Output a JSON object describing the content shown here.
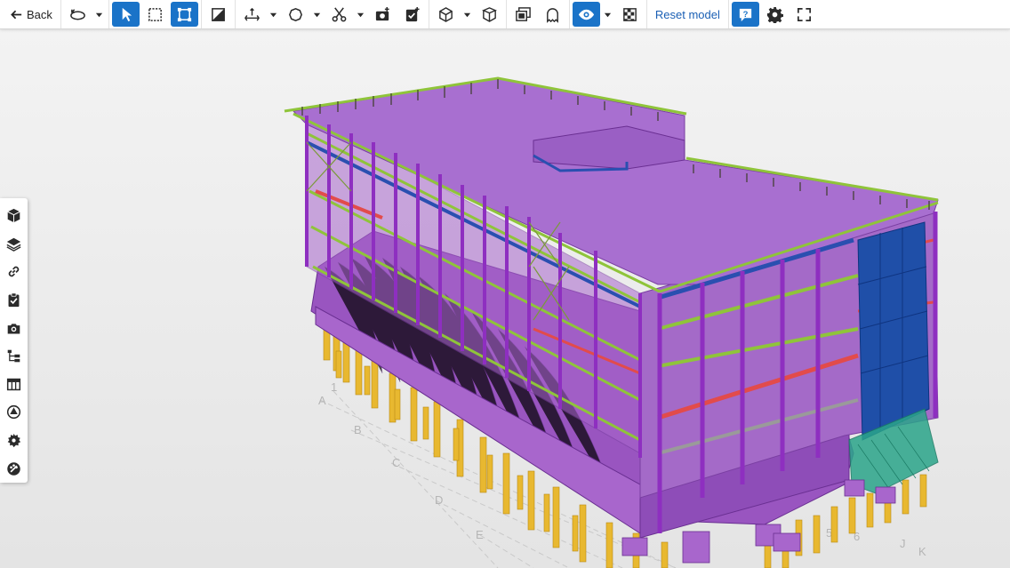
{
  "toolbar": {
    "back_label": "Back",
    "reset_label": "Reset model",
    "active_color": "#1a73c8",
    "tools": [
      {
        "name": "orbit",
        "icon": "orbit-icon",
        "active": false
      },
      {
        "name": "select",
        "icon": "cursor-icon",
        "active": true
      },
      {
        "name": "area-select",
        "icon": "area-select-icon",
        "active": false
      },
      {
        "name": "fit",
        "icon": "fit-bounds-icon",
        "active": true
      },
      {
        "name": "ghost",
        "icon": "ghost-toggle-icon",
        "active": false
      },
      {
        "name": "measure",
        "icon": "measure-icon",
        "active": false
      },
      {
        "name": "markup",
        "icon": "cloud-markup-icon",
        "active": false
      },
      {
        "name": "clip",
        "icon": "scissors-icon",
        "active": false
      },
      {
        "name": "snapshot",
        "icon": "camera-add-icon",
        "active": false
      },
      {
        "name": "add-todo",
        "icon": "todo-add-icon",
        "active": false
      },
      {
        "name": "section-box",
        "icon": "section-box-icon",
        "active": false
      },
      {
        "name": "explode",
        "icon": "open-box-icon",
        "active": false
      },
      {
        "name": "views",
        "icon": "stacked-views-icon",
        "active": false
      },
      {
        "name": "ghost-object",
        "icon": "ghost-icon",
        "active": false
      },
      {
        "name": "visibility",
        "icon": "eye-icon",
        "active": true
      },
      {
        "name": "transparency",
        "icon": "checker-icon",
        "active": false
      },
      {
        "name": "help",
        "icon": "help-icon",
        "active": true
      },
      {
        "name": "settings",
        "icon": "gear-icon",
        "active": false
      },
      {
        "name": "fullscreen",
        "icon": "fullscreen-icon",
        "active": false
      }
    ]
  },
  "sidebar": {
    "items": [
      {
        "name": "objects",
        "icon": "cube-icon"
      },
      {
        "name": "layers",
        "icon": "layers-icon"
      },
      {
        "name": "links",
        "icon": "link-icon"
      },
      {
        "name": "todos",
        "icon": "clipboard-check-icon"
      },
      {
        "name": "snapshots",
        "icon": "camera-icon"
      },
      {
        "name": "tree",
        "icon": "tree-icon"
      },
      {
        "name": "table",
        "icon": "table-icon"
      },
      {
        "name": "reference-models",
        "icon": "shapes-icon"
      },
      {
        "name": "extensions",
        "icon": "gear-burst-icon"
      },
      {
        "name": "clash",
        "icon": "palette-icon"
      }
    ]
  },
  "model": {
    "colors": {
      "concrete": "#a060c8",
      "concrete_dark": "#7a3fa2",
      "steel_green": "#8fc43a",
      "steel_blue": "#2a4fb0",
      "column": "#9a3cc8",
      "pile": "#e8b830",
      "facade_blue": "#1f4fa8",
      "red_beam": "#e24b4b",
      "teal": "#2aa58a"
    },
    "grid_labels": [
      "A",
      "B",
      "C",
      "D",
      "E",
      "1",
      "5",
      "6",
      "J",
      "K"
    ]
  }
}
